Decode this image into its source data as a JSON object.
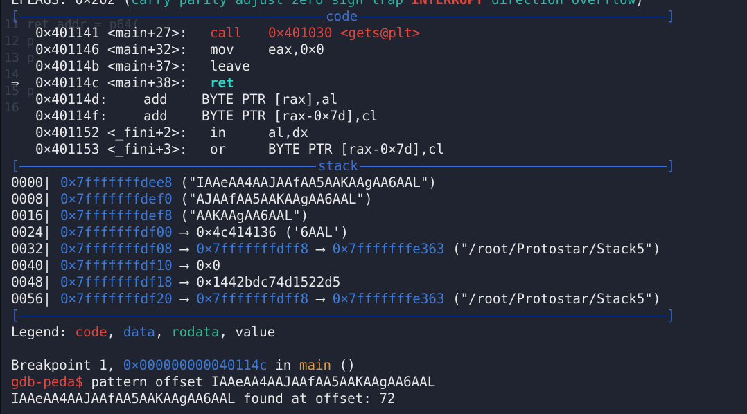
{
  "eflags": {
    "prefix": "EFLAGS: 0x202 (",
    "flags_a": "carry parity adjust zero sign trap ",
    "flag_set": "INTERRUPT",
    "flags_b": " direction overflow",
    "suffix": ")"
  },
  "ghost_lines": [
    "11 ret_addr = p64(",
    "12 p",
    "13 p",
    "14",
    "15 p",
    "16 "
  ],
  "sections": {
    "code_title": "code",
    "stack_title": "stack"
  },
  "code": {
    "rows": [
      {
        "marker": "  ",
        "addr": "0x401141 <main+27>:",
        "op": "call",
        "args": "0x401030 <gets@plt>",
        "style": "red"
      },
      {
        "marker": "  ",
        "addr": "0x401146 <main+32>:",
        "op": "mov",
        "args": "eax,0x0",
        "style": "normal"
      },
      {
        "marker": "  ",
        "addr": "0x40114b <main+37>:",
        "op": "leave",
        "args": "",
        "style": "normal"
      },
      {
        "marker": "=> ",
        "addr": "0x40114c <main+38>:",
        "op": "ret",
        "args": "",
        "style": "current"
      },
      {
        "marker": "  ",
        "addr": "0x40114d:",
        "op": "add",
        "args": "BYTE PTR [rax],al",
        "style": "short"
      },
      {
        "marker": "  ",
        "addr": "0x40114f:",
        "op": "add",
        "args": "BYTE PTR [rax-0x7d],cl",
        "style": "short"
      },
      {
        "marker": "  ",
        "addr": "0x401152 <_fini+2>:",
        "op": "in",
        "args": "al,dx",
        "style": "normal"
      },
      {
        "marker": "  ",
        "addr": "0x401153 <_fini+3>:",
        "op": "or",
        "args": "BYTE PTR [rax-0x7d],cl",
        "style": "normal"
      }
    ]
  },
  "stack": {
    "rows": [
      {
        "off": "0000|",
        "addr": "0x7fffffffdee8",
        "rest": [
          {
            "t": " (\"IAAeAA4AAJAAfAA5AAKAAgAA6AAL\")",
            "c": ""
          }
        ]
      },
      {
        "off": "0008|",
        "addr": "0x7fffffffdef0",
        "rest": [
          {
            "t": " (\"AJAAfAA5AAKAAgAA6AAL\")",
            "c": ""
          }
        ]
      },
      {
        "off": "0016|",
        "addr": "0x7fffffffdef8",
        "rest": [
          {
            "t": " (\"AAKAAgAA6AAL\")",
            "c": ""
          }
        ]
      },
      {
        "off": "0024|",
        "addr": "0x7fffffffdf00",
        "rest": [
          {
            "t": " --> 0x4c414136 ('6AAL')",
            "c": ""
          }
        ]
      },
      {
        "off": "0032|",
        "addr": "0x7fffffffdf08",
        "rest": [
          {
            "t": " --> ",
            "c": ""
          },
          {
            "t": "0x7fffffffdff8",
            "c": "blue"
          },
          {
            "t": " --> ",
            "c": ""
          },
          {
            "t": "0x7fffffffe363",
            "c": "blue"
          },
          {
            "t": " (\"/root/Protostar/Stack5\")",
            "c": ""
          }
        ]
      },
      {
        "off": "0040|",
        "addr": "0x7fffffffdf10",
        "rest": [
          {
            "t": " --> 0x0",
            "c": ""
          }
        ]
      },
      {
        "off": "0048|",
        "addr": "0x7fffffffdf18",
        "rest": [
          {
            "t": " --> 0x1442bdc74d1522d5",
            "c": ""
          }
        ]
      },
      {
        "off": "0056|",
        "addr": "0x7fffffffdf20",
        "rest": [
          {
            "t": " --> ",
            "c": ""
          },
          {
            "t": "0x7fffffffdff8",
            "c": "blue"
          },
          {
            "t": " --> ",
            "c": ""
          },
          {
            "t": "0x7fffffffe363",
            "c": "blue"
          },
          {
            "t": " (\"/root/Protostar/Stack5\")",
            "c": ""
          }
        ]
      }
    ]
  },
  "legend": {
    "label": "Legend: ",
    "code": "code",
    "sep1": ", ",
    "data": "data",
    "sep2": ", ",
    "rodata": "rodata",
    "sep3": ", ",
    "value": "value"
  },
  "breakpoint": {
    "prefix": "Breakpoint 1, ",
    "addr": "0x000000000040114c",
    "mid": " in ",
    "func": "main",
    "suffix": " ()"
  },
  "prompt": {
    "label": "gdb-peda$",
    "command": " pattern offset IAAeAA4AAJAAfAA5AAKAAgAA6AAL"
  },
  "result": {
    "text": "IAAeAA4AAJAAfAA5AAKAAgAA6AAL found at offset: 72"
  },
  "colors": {
    "background": "#1f2430",
    "separator": "#3d6fd6",
    "code": "#e0463c",
    "data": "#3d7ad8",
    "rodata": "#36b38e",
    "current_instruction": "#2fd8c6"
  }
}
